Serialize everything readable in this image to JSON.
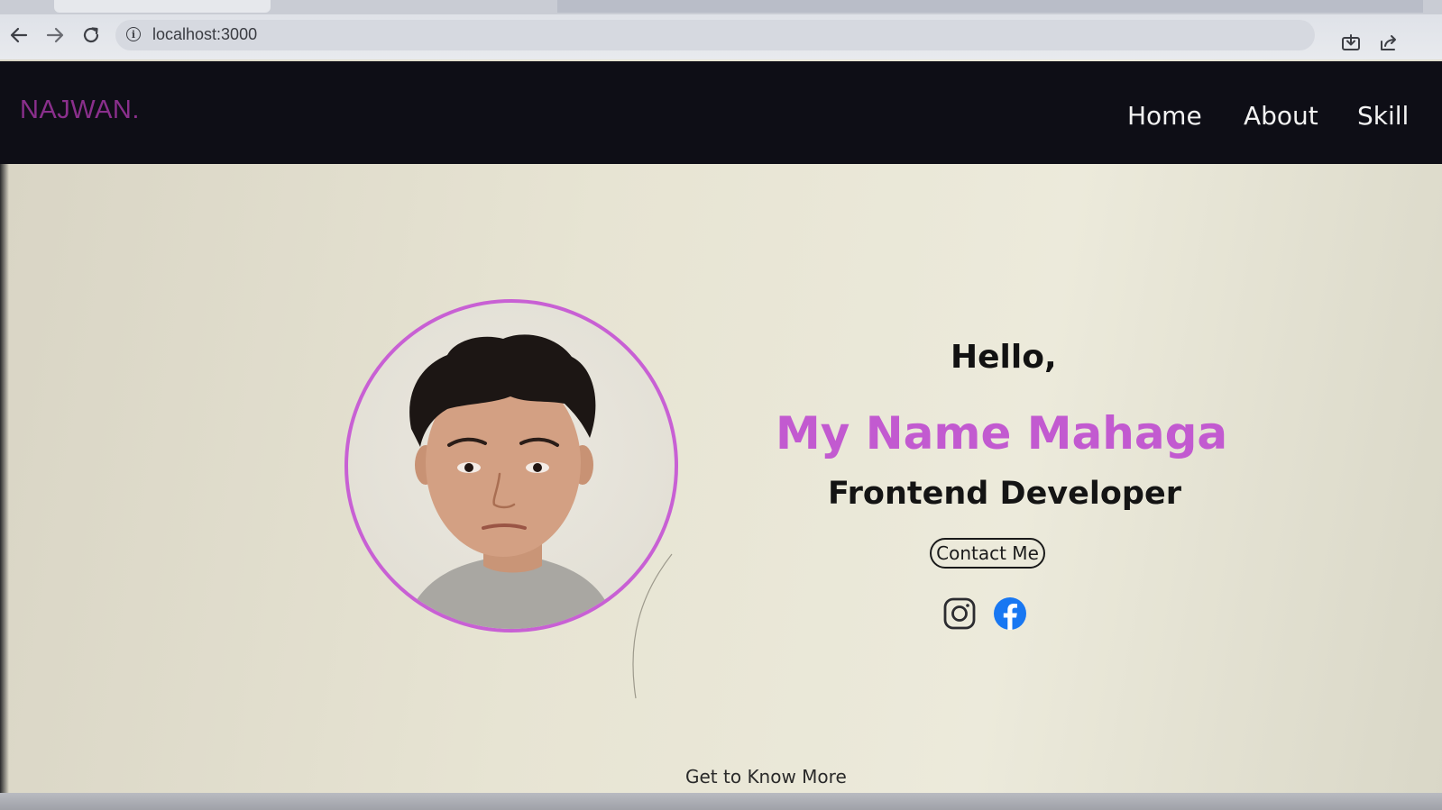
{
  "browser": {
    "url": "localhost:3000",
    "back_icon": "arrow-left-icon",
    "forward_icon": "arrow-right-icon",
    "reload_icon": "reload-icon",
    "info_icon": "info-icon",
    "install_icon": "install-app-icon",
    "share_icon": "share-icon"
  },
  "navbar": {
    "brand": "NAJWAN.",
    "links": [
      "Home",
      "About",
      "Skill"
    ]
  },
  "hero": {
    "greeting": "Hello,",
    "name": "My Name Mahaga",
    "role": "Frontend Developer",
    "contact_label": "Contact Me",
    "socials": [
      "instagram-icon",
      "facebook-icon"
    ]
  },
  "footer_link": "Get to Know More",
  "colors": {
    "accent": "#c25ad0",
    "brand": "#8a2f8c",
    "navbar_bg": "#0e0e16",
    "facebook": "#1877f2"
  }
}
